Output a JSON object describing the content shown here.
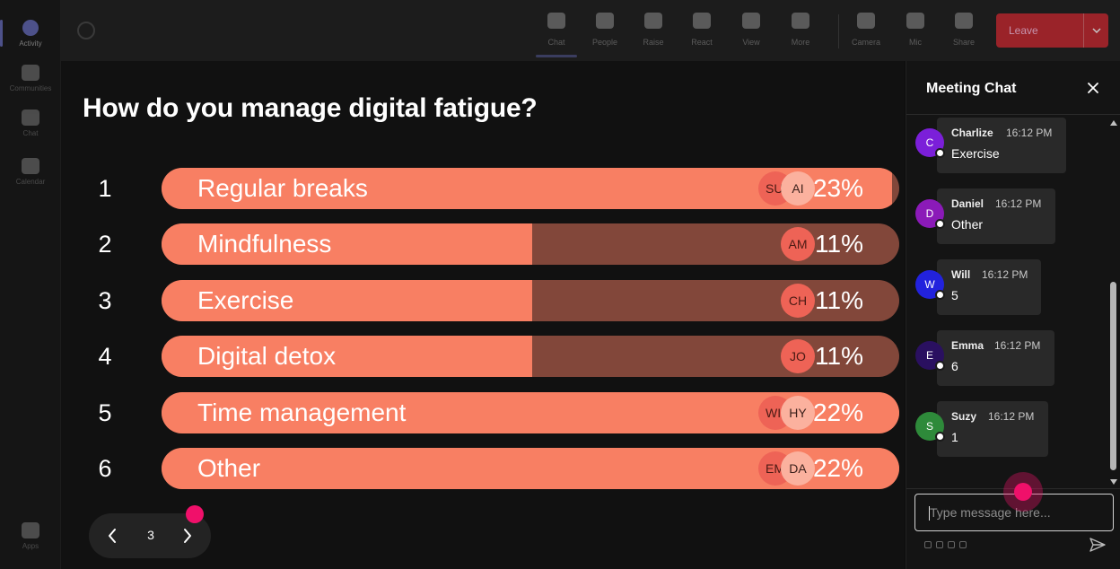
{
  "rail": {
    "items": [
      {
        "label": "Activity"
      },
      {
        "label": "Communities"
      },
      {
        "label": "Chat"
      },
      {
        "label": "Calendar"
      },
      {
        "label": "Apps"
      }
    ]
  },
  "toolbar": {
    "buttons": [
      {
        "label": "Chat",
        "icon": "chat-icon"
      },
      {
        "label": "People",
        "icon": "people-icon"
      },
      {
        "label": "Raise",
        "icon": "raise-hand-icon"
      },
      {
        "label": "React",
        "icon": "react-icon"
      },
      {
        "label": "View",
        "icon": "view-icon"
      },
      {
        "label": "More",
        "icon": "more-icon"
      },
      {
        "label": "Camera",
        "icon": "camera-icon"
      },
      {
        "label": "Mic",
        "icon": "mic-icon"
      },
      {
        "label": "Share",
        "icon": "share-icon"
      }
    ],
    "leave_label": "Leave"
  },
  "poll": {
    "question": "How do you manage digital fatigue?",
    "options": [
      {
        "num": "1",
        "label": "Regular breaks",
        "percent": "23%",
        "fill": 0.99,
        "avatars": [
          "SU",
          "AI"
        ]
      },
      {
        "num": "2",
        "label": "Mindfulness",
        "percent": "11%",
        "fill": 0.502,
        "avatars": [
          "AM"
        ]
      },
      {
        "num": "3",
        "label": "Exercise",
        "percent": "11%",
        "fill": 0.502,
        "avatars": [
          "CH"
        ]
      },
      {
        "num": "4",
        "label": "Digital detox",
        "percent": "11%",
        "fill": 0.502,
        "avatars": [
          "JO"
        ]
      },
      {
        "num": "5",
        "label": "Time management",
        "percent": "22%",
        "fill": 1.0,
        "avatars": [
          "WI",
          "HY"
        ]
      },
      {
        "num": "6",
        "label": "Other",
        "percent": "22%",
        "fill": 1.0,
        "avatars": [
          "EM",
          "DA"
        ]
      }
    ],
    "page": "3"
  },
  "chat": {
    "title": "Meeting Chat",
    "messages": [
      {
        "initial": "C",
        "name": "Charlize",
        "time": "16:12 PM",
        "text": "Exercise",
        "color": "#7b1fd9"
      },
      {
        "initial": "D",
        "name": "Daniel",
        "time": "16:12 PM",
        "text": "Other",
        "color": "#8b1ab8"
      },
      {
        "initial": "W",
        "name": "Will",
        "time": "16:12 PM",
        "text": "5",
        "color": "#2222dd"
      },
      {
        "initial": "E",
        "name": "Emma",
        "time": "16:12 PM",
        "text": "6",
        "color": "#2a1060"
      },
      {
        "initial": "S",
        "name": "Suzy",
        "time": "16:12 PM",
        "text": "1",
        "color": "#2e8a3a"
      }
    ],
    "compose_placeholder": "Type message here..."
  },
  "colors": {
    "bar_fill": "#f87f63",
    "bar_track": "#82473a",
    "accent": "#7b83eb",
    "leave": "#c4262e",
    "cursor": "#f0106a"
  }
}
